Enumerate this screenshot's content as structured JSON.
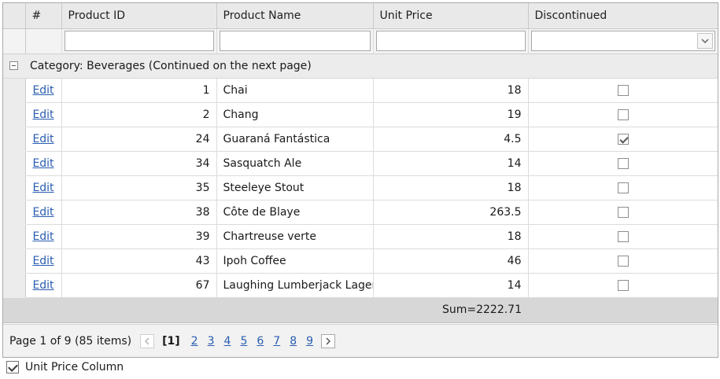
{
  "columns": {
    "indicator": "#",
    "product_id": "Product ID",
    "product_name": "Product Name",
    "unit_price": "Unit Price",
    "discontinued": "Discontinued"
  },
  "filters": {
    "product_id": "",
    "product_name": "",
    "unit_price": "",
    "discontinued": ""
  },
  "group": {
    "label": "Category: Beverages (Continued on the next page)"
  },
  "rows": [
    {
      "edit": "Edit",
      "id": "1",
      "name": "Chai",
      "price": "18",
      "discontinued": false
    },
    {
      "edit": "Edit",
      "id": "2",
      "name": "Chang",
      "price": "19",
      "discontinued": false
    },
    {
      "edit": "Edit",
      "id": "24",
      "name": "Guaraná Fantástica",
      "price": "4.5",
      "discontinued": true
    },
    {
      "edit": "Edit",
      "id": "34",
      "name": "Sasquatch Ale",
      "price": "14",
      "discontinued": false
    },
    {
      "edit": "Edit",
      "id": "35",
      "name": "Steeleye Stout",
      "price": "18",
      "discontinued": false
    },
    {
      "edit": "Edit",
      "id": "38",
      "name": "Côte de Blaye",
      "price": "263.5",
      "discontinued": false
    },
    {
      "edit": "Edit",
      "id": "39",
      "name": "Chartreuse verte",
      "price": "18",
      "discontinued": false
    },
    {
      "edit": "Edit",
      "id": "43",
      "name": "Ipoh Coffee",
      "price": "46",
      "discontinued": false
    },
    {
      "edit": "Edit",
      "id": "67",
      "name": "Laughing Lumberjack Lager",
      "price": "14",
      "discontinued": false
    }
  ],
  "footer": {
    "unit_price_summary": "Sum=2222.71"
  },
  "pager": {
    "summary": "Page 1 of 9 (85 items)",
    "current": "[1]",
    "pages": [
      "2",
      "3",
      "4",
      "5",
      "6",
      "7",
      "8",
      "9"
    ],
    "prev_icon": "chevron-left-icon",
    "next_icon": "chevron-right-icon"
  },
  "options": {
    "unit_price_column": {
      "label": "Unit Price Column",
      "checked": true
    }
  },
  "colors": {
    "link": "#2a5db0",
    "header_bg": "#e9e9e9",
    "footer_bg": "#d7d7d7"
  }
}
